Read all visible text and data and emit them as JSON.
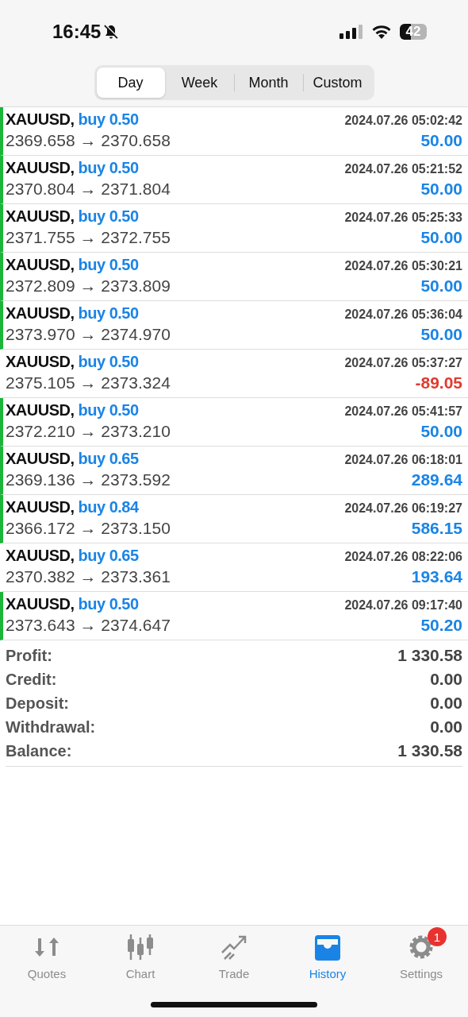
{
  "status_bar": {
    "time": "16:45",
    "battery": "42"
  },
  "segments": [
    {
      "label": "Day",
      "selected": true
    },
    {
      "label": "Week",
      "selected": false
    },
    {
      "label": "Month",
      "selected": false
    },
    {
      "label": "Custom",
      "selected": false
    }
  ],
  "deals": [
    {
      "symbol": "XAUUSD,",
      "side": "buy 0.50",
      "time": "2024.07.26 05:02:42",
      "prices": "2369.658 → 2370.658",
      "profit": "50.00",
      "negative": false,
      "marked": true
    },
    {
      "symbol": "XAUUSD,",
      "side": "buy 0.50",
      "time": "2024.07.26 05:21:52",
      "prices": "2370.804 → 2371.804",
      "profit": "50.00",
      "negative": false,
      "marked": true
    },
    {
      "symbol": "XAUUSD,",
      "side": "buy 0.50",
      "time": "2024.07.26 05:25:33",
      "prices": "2371.755 → 2372.755",
      "profit": "50.00",
      "negative": false,
      "marked": true
    },
    {
      "symbol": "XAUUSD,",
      "side": "buy 0.50",
      "time": "2024.07.26 05:30:21",
      "prices": "2372.809 → 2373.809",
      "profit": "50.00",
      "negative": false,
      "marked": true
    },
    {
      "symbol": "XAUUSD,",
      "side": "buy 0.50",
      "time": "2024.07.26 05:36:04",
      "prices": "2373.970 → 2374.970",
      "profit": "50.00",
      "negative": false,
      "marked": true
    },
    {
      "symbol": "XAUUSD,",
      "side": "buy 0.50",
      "time": "2024.07.26 05:37:27",
      "prices": "2375.105 → 2373.324",
      "profit": "-89.05",
      "negative": true,
      "marked": false
    },
    {
      "symbol": "XAUUSD,",
      "side": "buy 0.50",
      "time": "2024.07.26 05:41:57",
      "prices": "2372.210 → 2373.210",
      "profit": "50.00",
      "negative": false,
      "marked": true
    },
    {
      "symbol": "XAUUSD,",
      "side": "buy 0.65",
      "time": "2024.07.26 06:18:01",
      "prices": "2369.136 → 2373.592",
      "profit": "289.64",
      "negative": false,
      "marked": true
    },
    {
      "symbol": "XAUUSD,",
      "side": "buy 0.84",
      "time": "2024.07.26 06:19:27",
      "prices": "2366.172 → 2373.150",
      "profit": "586.15",
      "negative": false,
      "marked": true
    },
    {
      "symbol": "XAUUSD,",
      "side": "buy 0.65",
      "time": "2024.07.26 08:22:06",
      "prices": "2370.382 → 2373.361",
      "profit": "193.64",
      "negative": false,
      "marked": false
    },
    {
      "symbol": "XAUUSD,",
      "side": "buy 0.50",
      "time": "2024.07.26 09:17:40",
      "prices": "2373.643 → 2374.647",
      "profit": "50.20",
      "negative": false,
      "marked": true
    }
  ],
  "summary": [
    {
      "label": "Profit:",
      "value": "1 330.58"
    },
    {
      "label": "Credit:",
      "value": "0.00"
    },
    {
      "label": "Deposit:",
      "value": "0.00"
    },
    {
      "label": "Withdrawal:",
      "value": "0.00"
    },
    {
      "label": "Balance:",
      "value": "1 330.58"
    }
  ],
  "tab_bar": [
    {
      "kind": "quotes",
      "label": "Quotes",
      "selected": false
    },
    {
      "kind": "chart",
      "label": "Chart",
      "selected": false
    },
    {
      "kind": "trade",
      "label": "Trade",
      "selected": false
    },
    {
      "kind": "history",
      "label": "History",
      "selected": true
    },
    {
      "kind": "settings",
      "label": "Settings",
      "selected": false,
      "badge": "1"
    }
  ]
}
